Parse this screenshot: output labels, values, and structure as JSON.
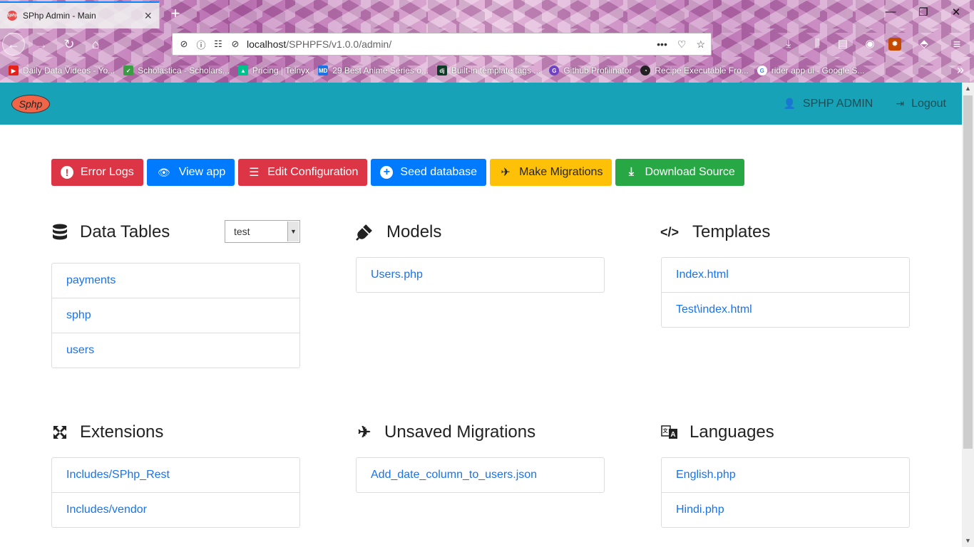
{
  "browser": {
    "tab_title": "SPhp Admin - Main",
    "url_host": "localhost",
    "url_path": "/SPHPFS/v1.0.0/admin/",
    "bookmarks": [
      {
        "label": "Daily Data Videos - Yo...",
        "icon": "youtube-icon",
        "color": "#e62117"
      },
      {
        "label": "Scholastica - Scholars...",
        "icon": "shield-check-icon",
        "color": "#3a9d42"
      },
      {
        "label": "Pricing | Telnyx",
        "icon": "telnyx-icon",
        "color": "#00c08b"
      },
      {
        "label": "29 Best Anime Series o...",
        "icon": "md-icon",
        "color": "#1a73e8"
      },
      {
        "label": "Built-in template tags ...",
        "icon": "django-icon",
        "color": "#0c3c26"
      },
      {
        "label": "Github Profilinator",
        "icon": "profilinator-icon",
        "color": "#6f42c1"
      },
      {
        "label": "Recipe Executable Fro...",
        "icon": "github-icon",
        "color": "#222222"
      },
      {
        "label": "rider app ui - Google S...",
        "icon": "google-icon",
        "color": "#4285f4"
      }
    ]
  },
  "header": {
    "logo": "Sphp",
    "user_label": "SPHP ADMIN",
    "logout_label": "Logout"
  },
  "toolbar": {
    "buttons": [
      {
        "label": "Error Logs",
        "icon": "exclamation-icon",
        "color": "#dc3545"
      },
      {
        "label": "View app",
        "icon": "eye-icon",
        "color": "#007bff"
      },
      {
        "label": "Edit Configuration",
        "icon": "sliders-icon",
        "color": "#dc3545"
      },
      {
        "label": "Seed database",
        "icon": "plus-circle-icon",
        "color": "#007bff"
      },
      {
        "label": "Make Migrations",
        "icon": "plane-icon",
        "color": "#ffc107"
      },
      {
        "label": "Download Source",
        "icon": "download-icon",
        "color": "#28a745"
      }
    ]
  },
  "sections": {
    "data_tables": {
      "title": "Data Tables",
      "icon": "database-icon",
      "select_value": "test",
      "items": [
        "payments",
        "sphp",
        "users"
      ]
    },
    "models": {
      "title": "Models",
      "icon": "plug-icon",
      "items": [
        "Users.php"
      ]
    },
    "templates": {
      "title": "Templates",
      "icon": "code-icon",
      "items": [
        "Index.html",
        "Test\\index.html"
      ]
    },
    "extensions": {
      "title": "Extensions",
      "icon": "expand-arrows-icon",
      "items": [
        "Includes/SPhp_Rest",
        "Includes/vendor"
      ]
    },
    "unsaved_migrations": {
      "title": "Unsaved Migrations",
      "icon": "plane-icon",
      "items": [
        "Add_date_column_to_users.json"
      ]
    },
    "languages": {
      "title": "Languages",
      "icon": "language-icon",
      "items": [
        "English.php",
        "Hindi.php"
      ]
    }
  }
}
